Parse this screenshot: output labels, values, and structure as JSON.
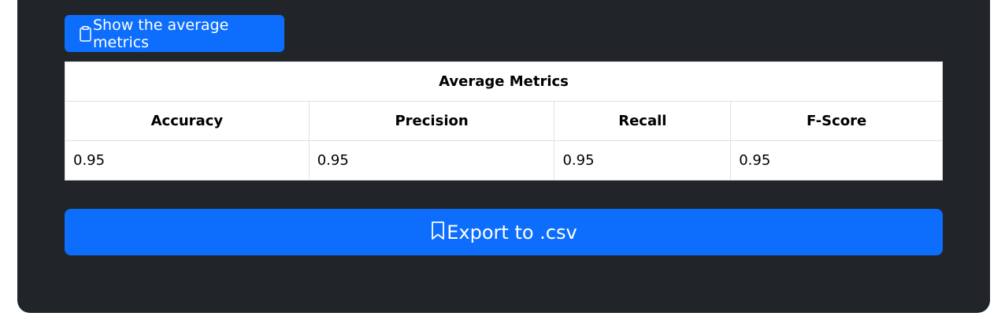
{
  "actions": {
    "show_metrics_label": "Show the average metrics",
    "show_metrics_icon": "clipboard-icon",
    "export_label": "Export to .csv",
    "export_icon": "bookmark-icon"
  },
  "table": {
    "title": "Average Metrics",
    "columns": [
      "Accuracy",
      "Precision",
      "Recall",
      "F-Score"
    ],
    "rows": [
      [
        "0.95",
        "0.95",
        "0.95",
        "0.95"
      ]
    ]
  },
  "colors": {
    "panel_background": "#212529",
    "primary_button": "#0d6efd",
    "table_border": "#dee2e6"
  }
}
